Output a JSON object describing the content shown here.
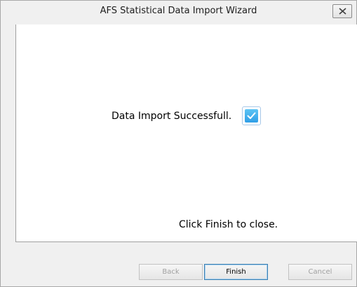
{
  "window": {
    "title": "AFS Statistical Data Import Wizard"
  },
  "content": {
    "message": "Data Import Successfull.",
    "status_icon": "checkbox-checked-icon",
    "hint": "Click Finish to close."
  },
  "buttons": {
    "back_label": "Back",
    "finish_label": "Finish",
    "cancel_label": "Cancel"
  },
  "colors": {
    "accent": "#2f9ee6",
    "default_button_border": "#3c7fb1",
    "disabled_text": "#a0a0a0"
  }
}
